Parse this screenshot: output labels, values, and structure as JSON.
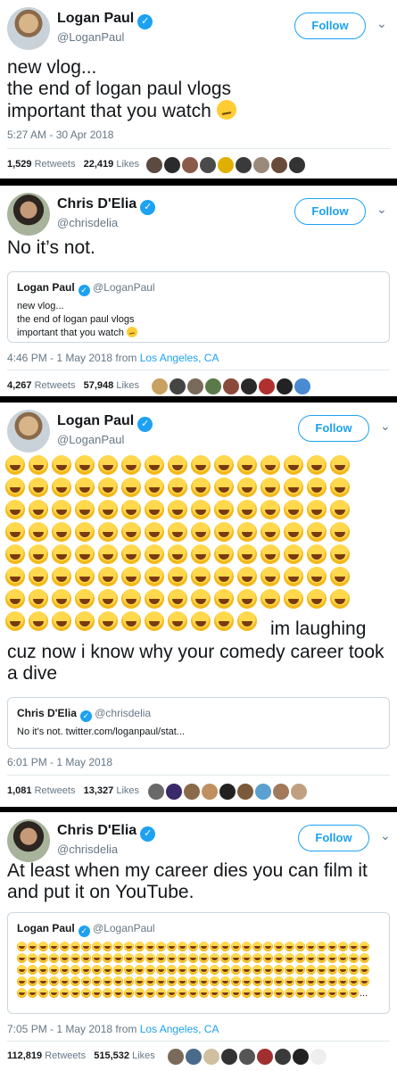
{
  "colors": {
    "link": "#1da1f2",
    "muted": "#657786",
    "text": "#14171a",
    "separator": "#000000"
  },
  "tweets": [
    {
      "name": "Logan Paul",
      "handle": "@LoganPaul",
      "follow": "Follow",
      "text": "new vlog...\nthe end of logan paul vlogs\nimportant that you watch",
      "timestamp": "5:27 AM - 30 Apr 2018",
      "retweets": "1,529",
      "retweets_label": "Retweets",
      "likes": "22,419",
      "likes_label": "Likes"
    },
    {
      "name": "Chris D'Elia",
      "handle": "@chrisdelia",
      "follow": "Follow",
      "text": "No it’s not.",
      "quote": {
        "name": "Logan Paul",
        "handle": "@LoganPaul",
        "text": "new vlog...\nthe end of logan paul vlogs\nimportant that you watch"
      },
      "timestamp": "4:46 PM - 1 May 2018 from ",
      "location": "Los Angeles, CA",
      "retweets": "4,267",
      "retweets_label": "Retweets",
      "likes": "57,948",
      "likes_label": "Likes"
    },
    {
      "name": "Logan Paul",
      "handle": "@LoganPaul",
      "follow": "Follow",
      "text_after_emoji": "im laughing",
      "text": "cuz now i know why your comedy career took\na dive",
      "quote": {
        "name": "Chris D'Elia",
        "handle": "@chrisdelia",
        "text": "No it's not. twitter.com/loganpaul/stat..."
      },
      "timestamp": "6:01 PM - 1 May 2018",
      "retweets": "1,081",
      "retweets_label": "Retweets",
      "likes": "13,327",
      "likes_label": "Likes"
    },
    {
      "name": "Chris D'Elia",
      "handle": "@chrisdelia",
      "follow": "Follow",
      "text": "At least when my career dies you can film it\nand put it on YouTube.",
      "quote": {
        "name": "Logan Paul",
        "handle": "@LoganPaul",
        "ellipsis": "..."
      },
      "timestamp": "7:05 PM - 1 May 2018 from ",
      "location": "Los Angeles, CA",
      "retweets": "112,819",
      "retweets_label": "Retweets",
      "likes": "515,532",
      "likes_label": "Likes"
    }
  ],
  "icons": {
    "verified": "verified-badge-icon",
    "chevron": "chevron-down-icon",
    "emoji_laugh": "face-with-tears-of-joy",
    "emoji_confused": "confused-face"
  }
}
